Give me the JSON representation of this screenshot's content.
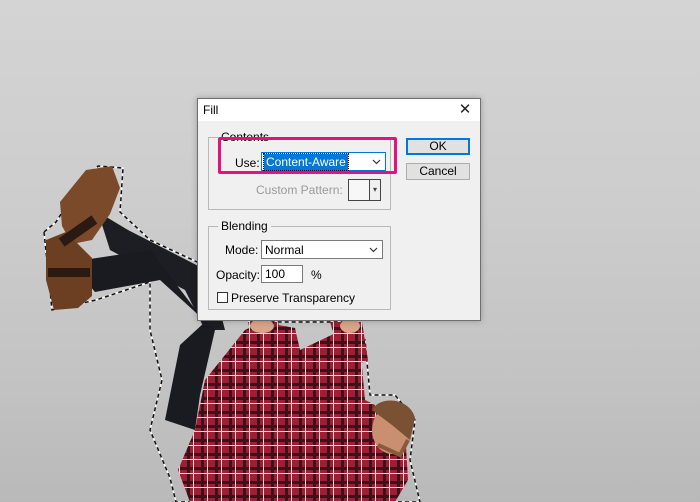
{
  "dialog": {
    "title": "Fill",
    "close_icon": "close-icon",
    "contents": {
      "legend": "Contents",
      "use_label": "Use:",
      "use_value": "Content-Aware",
      "custom_pattern_label": "Custom Pattern:"
    },
    "blending": {
      "legend": "Blending",
      "mode_label": "Mode:",
      "mode_value": "Normal",
      "opacity_label": "Opacity:",
      "opacity_value": "100",
      "opacity_unit": "%",
      "preserve_transparency_label": "Preserve Transparency",
      "preserve_transparency_checked": false
    },
    "ok_label": "OK",
    "cancel_label": "Cancel"
  },
  "colors": {
    "highlight": "#e6117c",
    "accent": "#0078d7",
    "shirt_red": "#b0263a",
    "boot_brown": "#7a4a2a"
  }
}
